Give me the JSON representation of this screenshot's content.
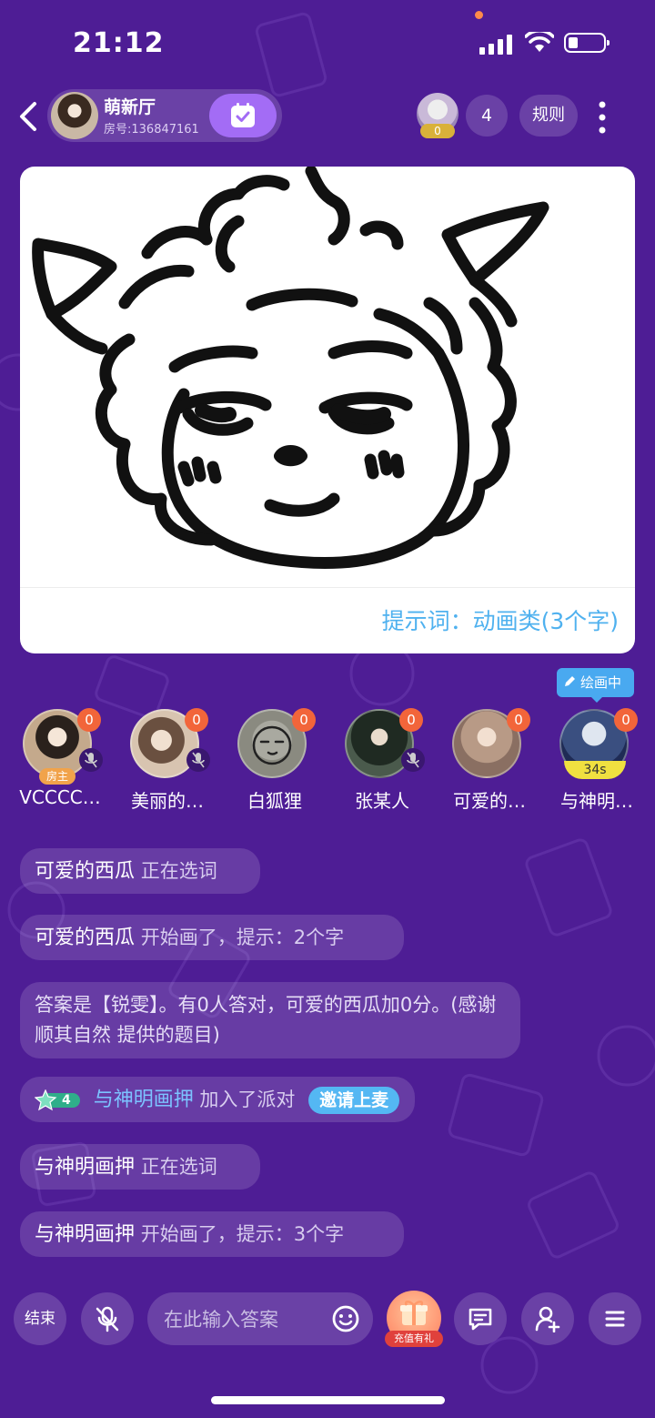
{
  "status_bar": {
    "time": "21:12"
  },
  "header": {
    "room_name": "萌新厅",
    "room_id": "房号:136847161",
    "top_user_badge": "0",
    "online_count": "4",
    "rules_label": "规则"
  },
  "canvas": {
    "hint": "提示词：动画类(3个字)"
  },
  "drawing_badge": "绘画中",
  "players": [
    {
      "name": "VCCCC…",
      "score": "0",
      "muted": true,
      "tag": "房主"
    },
    {
      "name": "美丽的…",
      "score": "0",
      "muted": true
    },
    {
      "name": "白狐狸",
      "score": "0",
      "muted": false
    },
    {
      "name": "张某人",
      "score": "0",
      "muted": true
    },
    {
      "name": "可爱的…",
      "score": "0",
      "muted": false
    },
    {
      "name": "与神明…",
      "score": "0",
      "muted": false,
      "timer": "34s"
    }
  ],
  "messages": [
    {
      "who": "可爱的西瓜",
      "text": "正在选词"
    },
    {
      "who": "可爱的西瓜",
      "text": "开始画了，提示：2个字"
    },
    {
      "text": "答案是【锐雯】。有0人答对，可爱的西瓜加0分。(感谢 顺其自然 提供的题目)"
    },
    {
      "level": "4",
      "who": "与神明画押",
      "text": "加入了派对",
      "action": "邀请上麦"
    },
    {
      "who": "与神明画押",
      "text": "正在选词"
    },
    {
      "who": "与神明画押",
      "text": "开始画了，提示：3个字"
    }
  ],
  "bottom_bar": {
    "end_label": "结束",
    "answer_placeholder": "在此输入答案",
    "gift_label": "充值有礼"
  },
  "colors": {
    "background": "#4e1d95",
    "accent": "#a36cf5",
    "hint_blue": "#4fb1ef",
    "score_orange": "#f2653a"
  }
}
